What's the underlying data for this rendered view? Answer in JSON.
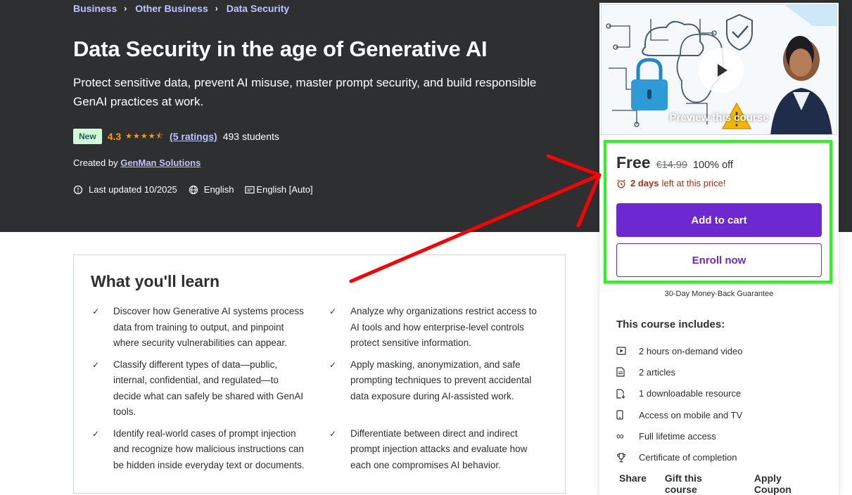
{
  "breadcrumb": [
    "Business",
    "Other Business",
    "Data Security"
  ],
  "course": {
    "title": "Data Security in the age of Generative AI",
    "subtitle": "Protect sensitive data, prevent AI misuse, master prompt security, and build responsible GenAI practices at work.",
    "badge": "New",
    "rating": "4.3",
    "ratings_count": "(5 ratings)",
    "students": "493 students",
    "created_by_label": "Created by",
    "instructor": "GenMan Solutions",
    "last_updated": "Last updated 10/2025",
    "language": "English",
    "captions": "English [Auto]"
  },
  "learn": {
    "title": "What you'll learn",
    "items": [
      "Discover how Generative AI systems process data from training to output, and pinpoint where security vulnerabilities can appear.",
      "Analyze why organizations restrict access to AI tools and how enterprise-level controls protect sensitive information.",
      "Classify different types of data—public, internal, confidential, and regulated—to decide what can safely be shared with GenAI tools.",
      "Apply masking, anonymization, and safe prompting techniques to prevent accidental data exposure during AI-assisted work.",
      "Identify real-world cases of prompt injection and recognize how malicious instructions can be hidden inside everyday text or documents.",
      "Differentiate between direct and indirect prompt injection attacks and evaluate how each one compromises AI behavior."
    ]
  },
  "sidebar": {
    "preview_caption": "Preview this course",
    "price": "Free",
    "original_price": "€14.99",
    "discount": "100% off",
    "days_left_bold": "2 days",
    "days_left_rest": "left at this price!",
    "add_to_cart": "Add to cart",
    "enroll_now": "Enroll now",
    "guarantee": "30-Day Money-Back Guarantee",
    "includes_title": "This course includes:",
    "includes": [
      {
        "icon": "video-icon",
        "text": "2 hours on-demand video"
      },
      {
        "icon": "article-icon",
        "text": "2 articles"
      },
      {
        "icon": "download-icon",
        "text": "1 downloadable resource"
      },
      {
        "icon": "mobile-icon",
        "text": "Access on mobile and TV"
      },
      {
        "icon": "infinity-icon",
        "text": "Full lifetime access"
      },
      {
        "icon": "trophy-icon",
        "text": "Certificate of completion"
      }
    ],
    "footer": [
      "Share",
      "Gift this course",
      "Apply Coupon"
    ]
  },
  "colors": {
    "hero_bg": "#2d2f31",
    "accent_purple": "#6d28d2",
    "link_lavender": "#c0c4fc",
    "star": "#f69c08",
    "highlight_box": "#1eff14",
    "annotation_arrow": "#ff0000"
  }
}
